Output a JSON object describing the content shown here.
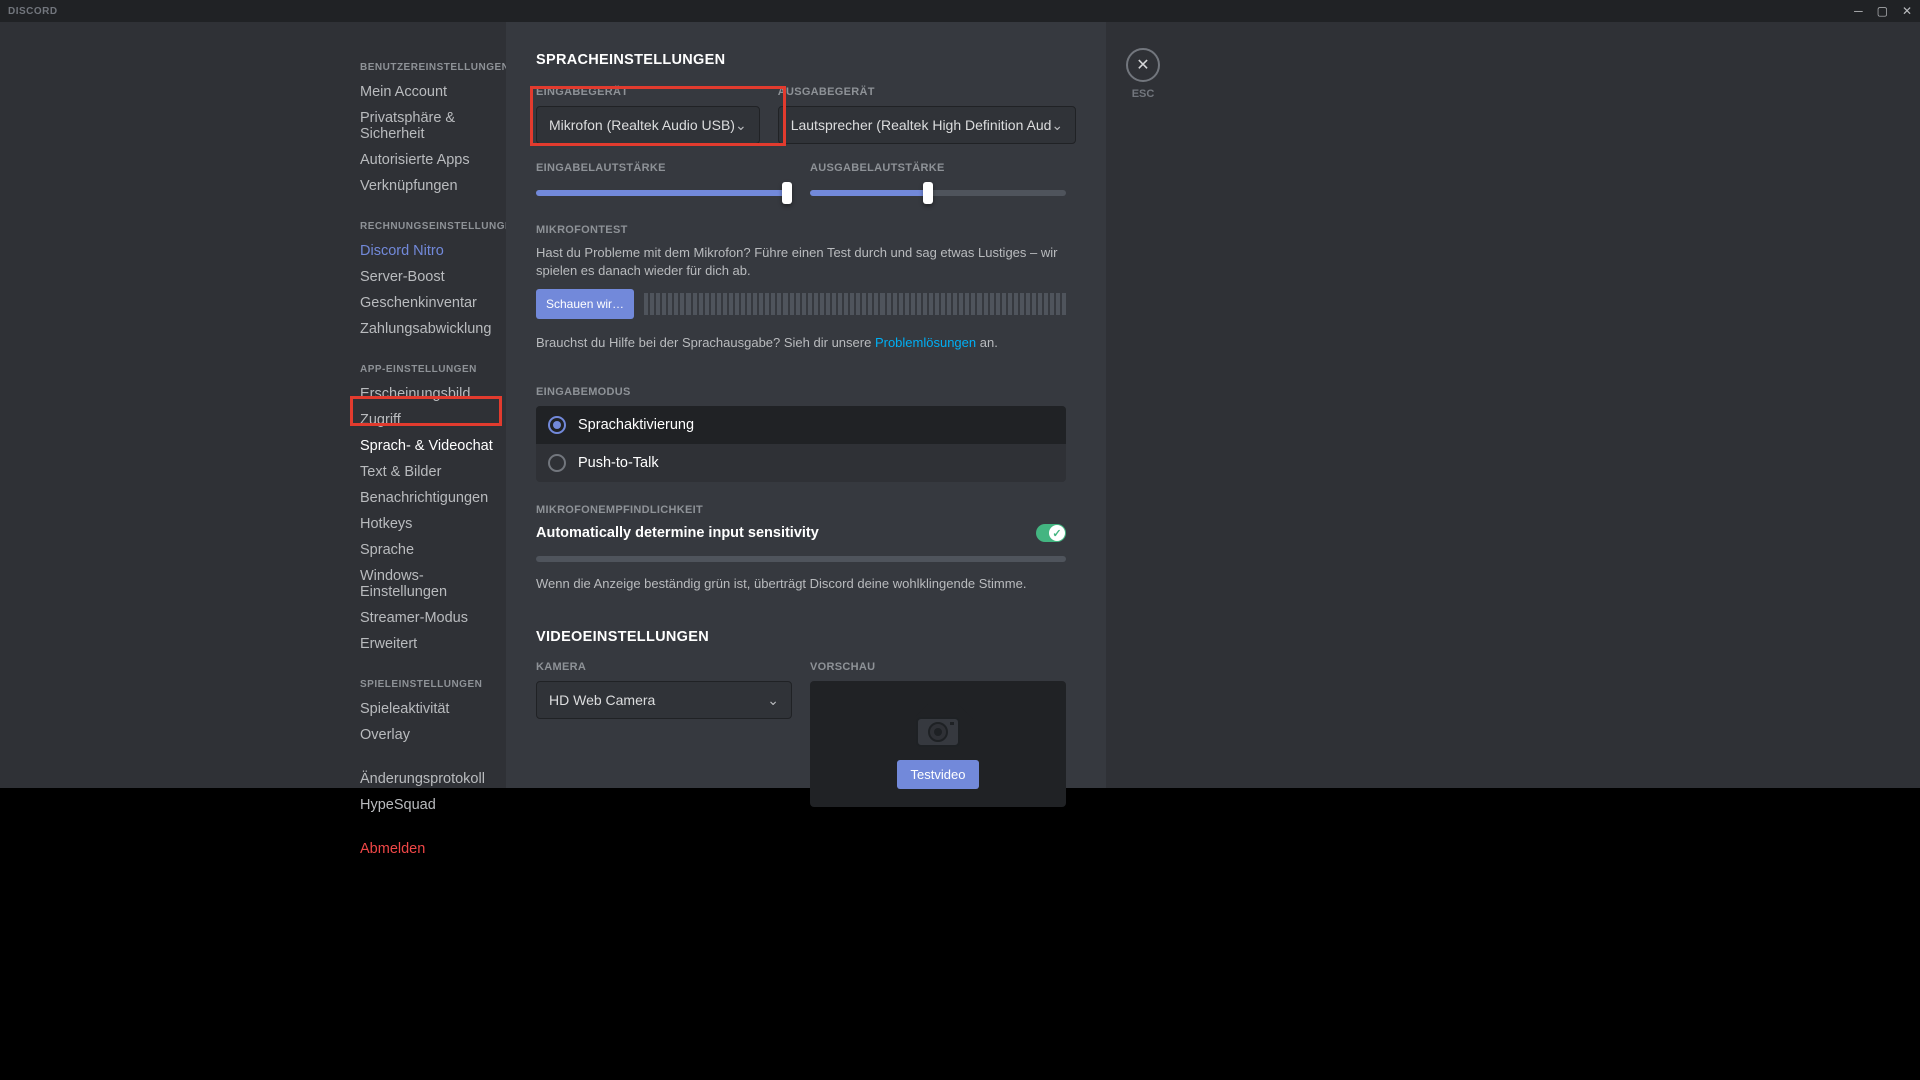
{
  "titlebar": {
    "brand": "DISCORD"
  },
  "sidebar": {
    "groups": [
      {
        "header": "BENUTZEREINSTELLUNGEN",
        "items": [
          {
            "label": "Mein Account"
          },
          {
            "label": "Privatsphäre & Sicherheit"
          },
          {
            "label": "Autorisierte Apps"
          },
          {
            "label": "Verknüpfungen"
          }
        ]
      },
      {
        "header": "RECHNUNGSEINSTELLUNGEN",
        "items": [
          {
            "label": "Discord Nitro",
            "accent": true
          },
          {
            "label": "Server-Boost"
          },
          {
            "label": "Geschenkinventar"
          },
          {
            "label": "Zahlungsabwicklung"
          }
        ]
      },
      {
        "header": "APP-EINSTELLUNGEN",
        "items": [
          {
            "label": "Erscheinungsbild"
          },
          {
            "label": "Zugriff"
          },
          {
            "label": "Sprach- & Videochat",
            "active": true
          },
          {
            "label": "Text & Bilder"
          },
          {
            "label": "Benachrichtigungen"
          },
          {
            "label": "Hotkeys"
          },
          {
            "label": "Sprache"
          },
          {
            "label": "Windows-Einstellungen"
          },
          {
            "label": "Streamer-Modus"
          },
          {
            "label": "Erweitert"
          }
        ]
      },
      {
        "header": "SPIELEINSTELLUNGEN",
        "items": [
          {
            "label": "Spieleaktivität"
          },
          {
            "label": "Overlay"
          }
        ]
      },
      {
        "header": "",
        "items": [
          {
            "label": "Änderungsprotokoll"
          },
          {
            "label": "HypeSquad"
          }
        ]
      },
      {
        "header": "",
        "items": [
          {
            "label": "Abmelden",
            "danger": true
          }
        ]
      }
    ]
  },
  "page": {
    "title": "SPRACHEINSTELLUNGEN",
    "input_device_label": "EINGABEGERÄT",
    "input_device_value": "Mikrofon (Realtek Audio USB)",
    "output_device_label": "AUSGABEGERÄT",
    "output_device_value": "Lautsprecher (Realtek High Definition Aud",
    "input_vol_label": "EINGABELAUTSTÄRKE",
    "output_vol_label": "AUSGABELAUTSTÄRKE",
    "input_vol_pct": 98,
    "output_vol_pct": 46,
    "mictest_label": "MIKROFONTEST",
    "mictest_desc": "Hast du Probleme mit dem Mikrofon? Führe einen Test durch und sag etwas Lustiges – wir spielen es danach wieder für dich ab.",
    "mictest_button": "Schauen wir…",
    "help_prefix": "Brauchst du Hilfe bei der Sprachausgabe? Sieh dir unsere ",
    "help_link": "Problemlösungen",
    "help_suffix": " an.",
    "inputmode_label": "EINGABEMODUS",
    "inputmode_options": {
      "voice": "Sprachaktivierung",
      "ptt": "Push-to-Talk"
    },
    "sens_label": "MIKROFONEMPFINDLICHKEIT",
    "sens_auto": "Automatically determine input sensitivity",
    "sens_help": "Wenn die Anzeige beständig grün ist, überträgt Discord deine wohlklingende Stimme.",
    "video_title": "VIDEOEINSTELLUNGEN",
    "camera_label": "KAMERA",
    "camera_value": "HD Web Camera",
    "preview_label": "VORSCHAU",
    "preview_button": "Testvideo",
    "close_label": "ESC"
  }
}
